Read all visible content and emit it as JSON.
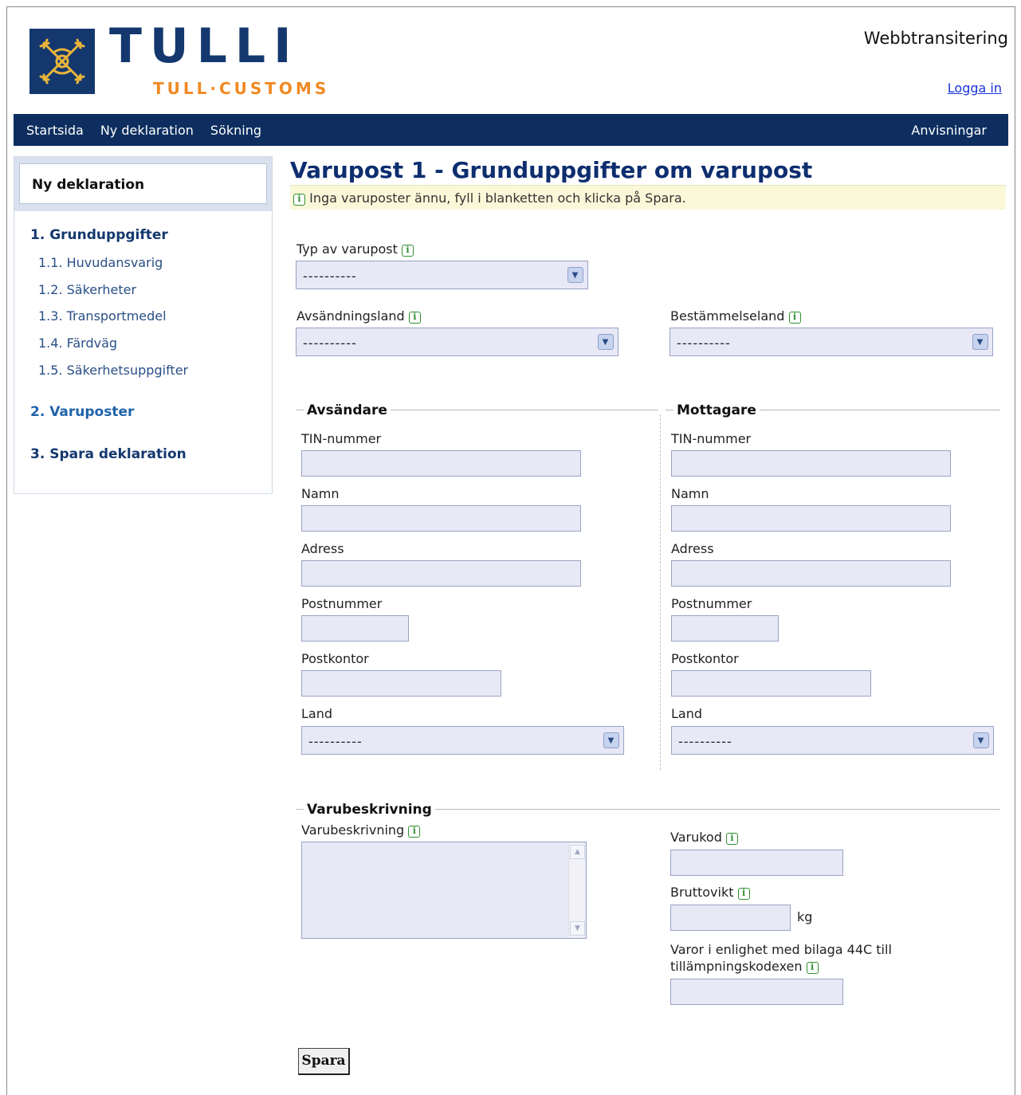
{
  "header": {
    "brand": "TULLI",
    "brand_sub": "TULL·CUSTOMS",
    "site_title": "Webbtransitering",
    "login_link": "Logga in",
    "logo": "tulli-emblem-icon"
  },
  "nav": {
    "items": [
      "Startsida",
      "Ny deklaration",
      "Sökning"
    ],
    "right": "Anvisningar"
  },
  "sidebar": {
    "heading": "Ny deklaration",
    "steps": [
      {
        "label": "1. Grunduppgifter",
        "subs": [
          "1.1. Huvudansvarig",
          "1.2. Säkerheter",
          "1.3. Transportmedel",
          "1.4. Färdväg",
          "1.5. Säkerhetsuppgifter"
        ]
      },
      {
        "label": "2. Varuposter",
        "subs": []
      },
      {
        "label": "3. Spara deklaration",
        "subs": []
      }
    ]
  },
  "main": {
    "title": "Varupost 1 - Grunduppgifter om varupost",
    "notice": "Inga varuposter ännu, fyll i blanketten och klicka på Spara.",
    "typ_label": "Typ av varupost",
    "typ_value": "----------",
    "avs_land_label": "Avsändningsland",
    "avs_land_value": "----------",
    "best_land_label": "Bestämmelseland",
    "best_land_value": "----------"
  },
  "avsandare": {
    "legend": "Avsändare",
    "tin": "TIN-nummer",
    "namn": "Namn",
    "adress": "Adress",
    "postnummer": "Postnummer",
    "postkontor": "Postkontor",
    "land": "Land",
    "land_value": "----------"
  },
  "mottagare": {
    "legend": "Mottagare",
    "tin": "TIN-nummer",
    "namn": "Namn",
    "adress": "Adress",
    "postnummer": "Postnummer",
    "postkontor": "Postkontor",
    "land": "Land",
    "land_value": "----------"
  },
  "varubeskrivning": {
    "legend": "Varubeskrivning",
    "desc_label": "Varubeskrivning",
    "varukod_label": "Varukod",
    "bruttovikt_label": "Bruttovikt",
    "unit": "kg",
    "bilaga_line1": "Varor i enlighet med bilaga 44C till",
    "bilaga_line2": "tillämpningskodexen"
  },
  "actions": {
    "save": "Spara"
  },
  "colors": {
    "navy": "#0d2e5f",
    "orange": "#f08a24",
    "field_bg": "#e8e8f6",
    "notice_bg": "#fbf8d9"
  }
}
